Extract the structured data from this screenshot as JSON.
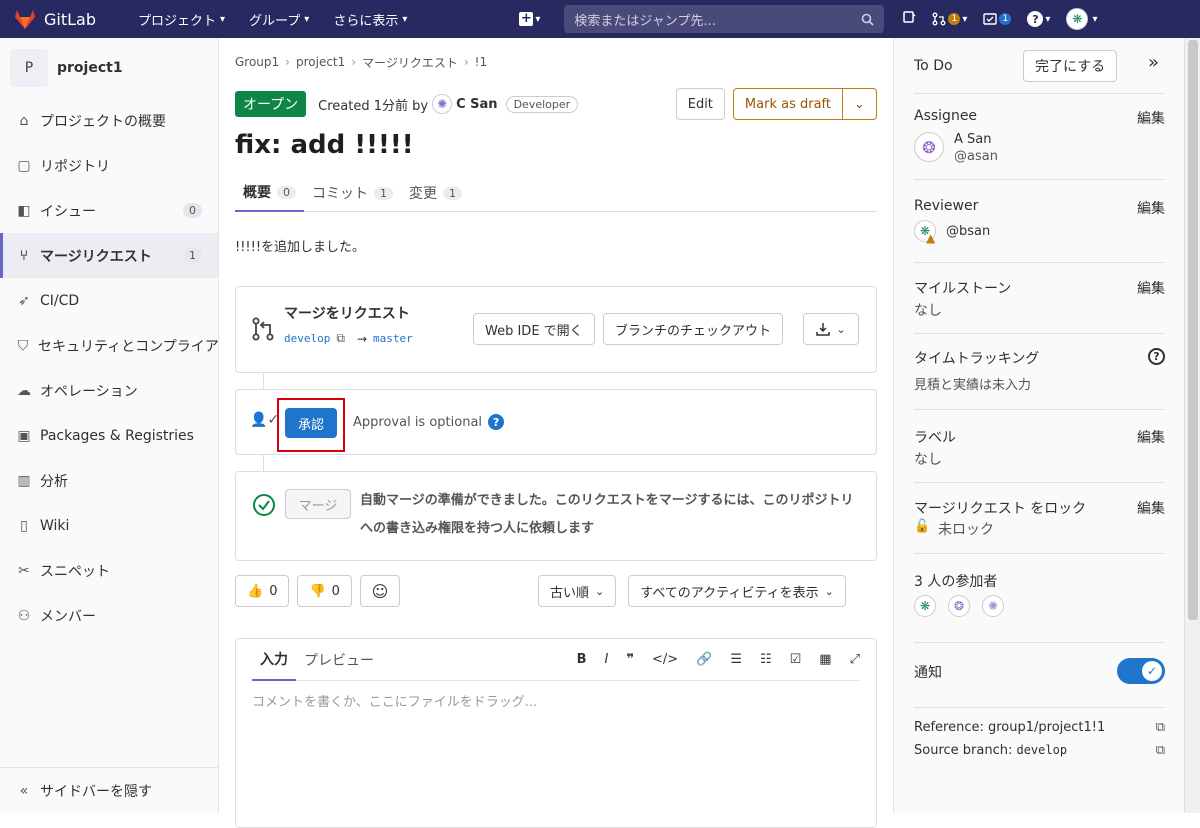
{
  "topbar": {
    "brand": "GitLab",
    "nav": [
      "プロジェクト",
      "グループ",
      "さらに表示"
    ],
    "search_placeholder": "検索またはジャンプ先...",
    "mr_badge": "1",
    "todo_badge": "1",
    "brand_color": "#292961"
  },
  "sidebar": {
    "project_initial": "P",
    "project_name": "project1",
    "items": [
      {
        "label": "プロジェクトの概要",
        "icon": "home-icon"
      },
      {
        "label": "リポジトリ",
        "icon": "doc-icon"
      },
      {
        "label": "イシュー",
        "icon": "issues-icon",
        "count": "0"
      },
      {
        "label": "マージリクエスト",
        "icon": "merge-request-icon",
        "count": "1",
        "active": true
      },
      {
        "label": "CI/CD",
        "icon": "rocket-icon"
      },
      {
        "label": "セキュリティとコンプライアンス",
        "icon": "shield-icon"
      },
      {
        "label": "オペレーション",
        "icon": "cloud-icon"
      },
      {
        "label": "Packages & Registries",
        "icon": "package-icon"
      },
      {
        "label": "分析",
        "icon": "chart-icon"
      },
      {
        "label": "Wiki",
        "icon": "book-icon"
      },
      {
        "label": "スニペット",
        "icon": "scissors-icon"
      },
      {
        "label": "メンバー",
        "icon": "users-icon"
      }
    ],
    "hide_label": "サイドバーを隠す"
  },
  "breadcrumb": [
    "Group1",
    "project1",
    "マージリクエスト",
    "!1"
  ],
  "mr": {
    "status": "オープン",
    "created": "Created 1分前 by",
    "author": "C San",
    "role": "Developer",
    "edit_label": "Edit",
    "draft_label": "Mark as draft",
    "title": "fix: add !!!!!",
    "tabs": [
      {
        "label": "概要",
        "count": "0"
      },
      {
        "label": "コミット",
        "count": "1"
      },
      {
        "label": "変更",
        "count": "1"
      }
    ],
    "description": "!!!!!を追加しました。"
  },
  "merge_widget": {
    "title": "マージをリクエスト",
    "source": "develop",
    "arrow": "→",
    "target": "master",
    "webide_label": "Web IDE で開く",
    "checkout_label": "ブランチのチェックアウト"
  },
  "approval": {
    "approve_label": "承認",
    "optional_text": "Approval is optional",
    "help": "?"
  },
  "merge_status": {
    "merge_label": "マージ",
    "message": "自動マージの準備ができました。このリクエストをマージするには、このリポジトリへの書き込み権限を持つ人に依頼します"
  },
  "reactions": {
    "thumbs_up": "0",
    "thumbs_down": "0",
    "sort_label": "古い順",
    "filter_label": "すべてのアクティビティを表示"
  },
  "comment": {
    "tab_write": "入力",
    "tab_preview": "プレビュー",
    "placeholder": "コメントを書くか、ここにファイルをドラッグ..."
  },
  "right_sidebar": {
    "todo_label": "To Do",
    "done_label": "完了にする",
    "edit_label": "編集",
    "assignee_label": "Assignee",
    "assignee_name": "A San",
    "assignee_user": "@asan",
    "reviewer_label": "Reviewer",
    "reviewer_user": "@bsan",
    "milestone_label": "マイルストーン",
    "milestone_value": "なし",
    "time_label": "タイムトラッキング",
    "time_value": "見積と実績は未入力",
    "labels_label": "ラベル",
    "labels_value": "なし",
    "lock_label": "マージリクエスト をロック",
    "lock_value": "未ロック",
    "participants_label": "3 人の参加者",
    "notify_label": "通知",
    "reference_label": "Reference: group1/project1!1",
    "source_branch_prefix": "Source branch: ",
    "source_branch_value": "develop"
  }
}
